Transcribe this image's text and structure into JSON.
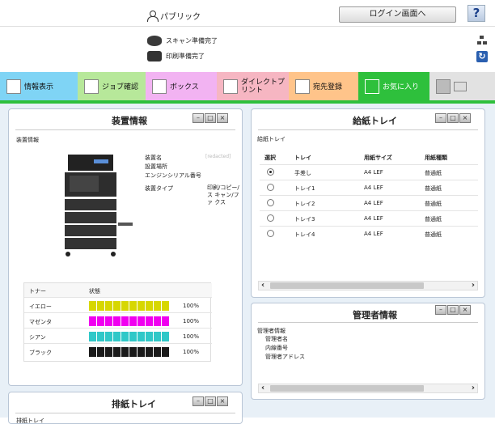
{
  "header": {
    "user_label": "パブリック",
    "login_button": "ログイン画面へ",
    "help_button": "?"
  },
  "status": {
    "scan": "スキャン準備完了",
    "print": "印刷準備完了"
  },
  "tabs": [
    {
      "label": "情報表示",
      "color": "#7fd4f5"
    },
    {
      "label": "ジョブ確認",
      "color": "#b7e89a"
    },
    {
      "label": "ボックス",
      "color": "#f2b3f2"
    },
    {
      "label": "ダイレクトプリント",
      "color": "#f6b6c2"
    },
    {
      "label": "宛先登録",
      "color": "#ffc48a"
    },
    {
      "label": "お気に入り",
      "color": "#2ec03c"
    },
    {
      "label": "",
      "color": "#e2e2e2"
    }
  ],
  "device_panel": {
    "title": "装置情報",
    "section": "装置情報",
    "fields": [
      {
        "label": "装置名",
        "value": "[redacted]"
      },
      {
        "label": "設置場所",
        "value": ""
      },
      {
        "label": "エンジンシリアル番号",
        "value": ""
      },
      {
        "label": "装置タイプ",
        "value": "印刷/コピー/ス キャン/ファ クス"
      }
    ],
    "toner_header": {
      "name": "トナー",
      "state": "状態"
    },
    "toners": [
      {
        "name": "イエロー",
        "percent": "100%",
        "color": "#d7d700"
      },
      {
        "name": "マゼンタ",
        "percent": "100%",
        "color": "#f000f0"
      },
      {
        "name": "シアン",
        "percent": "100%",
        "color": "#30c8c8"
      },
      {
        "name": "ブラック",
        "percent": "100%",
        "color": "#1a1a1a"
      }
    ]
  },
  "paper_panel": {
    "title": "給紙トレイ",
    "section": "給紙トレイ",
    "columns": [
      "選択",
      "トレイ",
      "用紙サイズ",
      "用紙種類"
    ],
    "rows": [
      {
        "tray": "手差し",
        "size": "A4 LEF",
        "type": "普通紙",
        "selected": true
      },
      {
        "tray": "トレイ1",
        "size": "A4 LEF",
        "type": "普通紙",
        "selected": false
      },
      {
        "tray": "トレイ2",
        "size": "A4 LEF",
        "type": "普通紙",
        "selected": false
      },
      {
        "tray": "トレイ3",
        "size": "A4 LEF",
        "type": "普通紙",
        "selected": false
      },
      {
        "tray": "トレイ4",
        "size": "A4 LEF",
        "type": "普通紙",
        "selected": false
      }
    ]
  },
  "admin_panel": {
    "title": "管理者情報",
    "section": "管理者情報",
    "fields": [
      "管理者名",
      "内線番号",
      "管理者アドレス"
    ]
  },
  "output_panel": {
    "title": "排紙トレイ",
    "section": "排紙トレイ"
  }
}
